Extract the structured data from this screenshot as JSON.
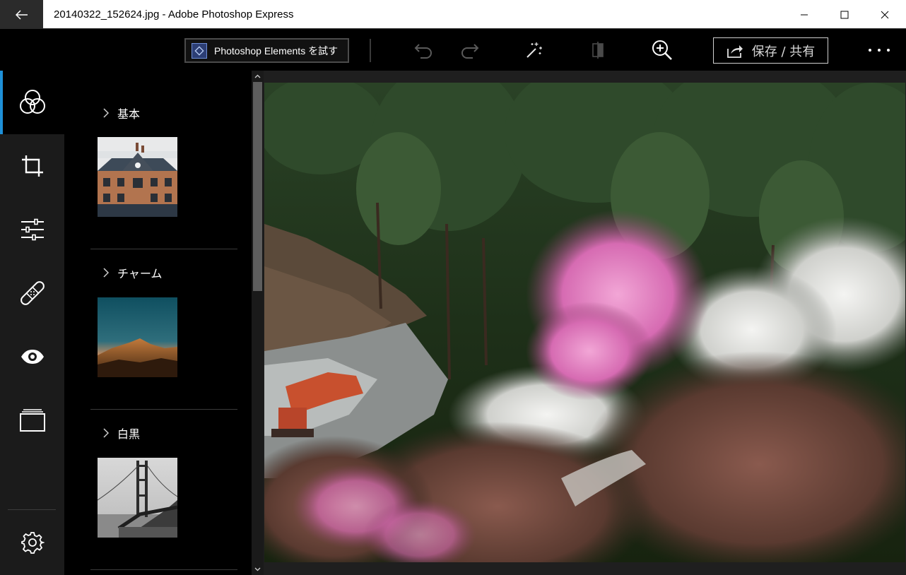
{
  "window": {
    "title": "20140322_152624.jpg - Adobe Photoshop Express",
    "back_icon": "back-arrow-icon",
    "minimize_icon": "minimize-icon",
    "maximize_icon": "maximize-icon",
    "close_icon": "close-icon"
  },
  "toolbar": {
    "try_elements_label": "Photoshop Elements を試す",
    "save_share_label": "保存 / 共有",
    "icons": [
      "undo-icon",
      "redo-icon",
      "auto-fix-wand-icon",
      "compare-icon",
      "zoom-in-icon",
      "share-icon",
      "more-icon"
    ]
  },
  "rail": {
    "items": [
      "looks-icon",
      "crop-icon",
      "adjustments-icon",
      "healing-bandage-icon",
      "red-eye-icon",
      "borders-icon"
    ],
    "settings_icon": "gear-icon",
    "accent_color": "#1e90d8"
  },
  "panel": {
    "sections": [
      {
        "title": "基本"
      },
      {
        "title": "チャーム"
      },
      {
        "title": "白黒"
      }
    ]
  }
}
